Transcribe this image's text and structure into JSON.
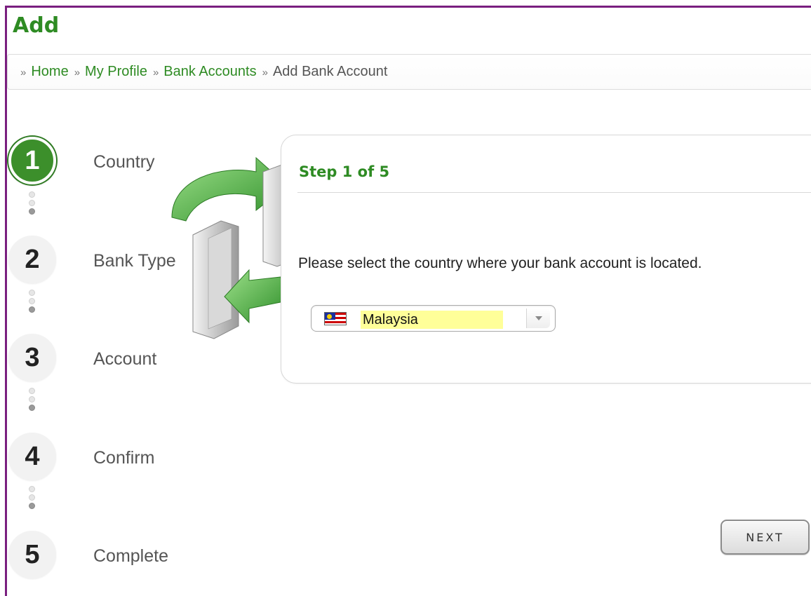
{
  "page": {
    "title": "Add"
  },
  "breadcrumb": {
    "separator": "»",
    "items": [
      {
        "label": "Home"
      },
      {
        "label": "My Profile"
      },
      {
        "label": "Bank Accounts"
      },
      {
        "label": "Add Bank Account"
      }
    ]
  },
  "steps": [
    {
      "number": "1",
      "label": "Country",
      "active": true
    },
    {
      "number": "2",
      "label": "Bank Type",
      "active": false
    },
    {
      "number": "3",
      "label": "Account",
      "active": false
    },
    {
      "number": "4",
      "label": "Confirm",
      "active": false
    },
    {
      "number": "5",
      "label": "Complete",
      "active": false
    }
  ],
  "card": {
    "title": "Step 1 of 5",
    "instruction": "Please select the country where your bank account is located."
  },
  "country_select": {
    "value": "Malaysia",
    "flag_icon": "malaysia-flag-icon"
  },
  "actions": {
    "next_label": "NEXT"
  },
  "colors": {
    "brand_green": "#2e8b23",
    "frame_purple": "#7a1f7f",
    "highlight_yellow": "#ffff99"
  }
}
